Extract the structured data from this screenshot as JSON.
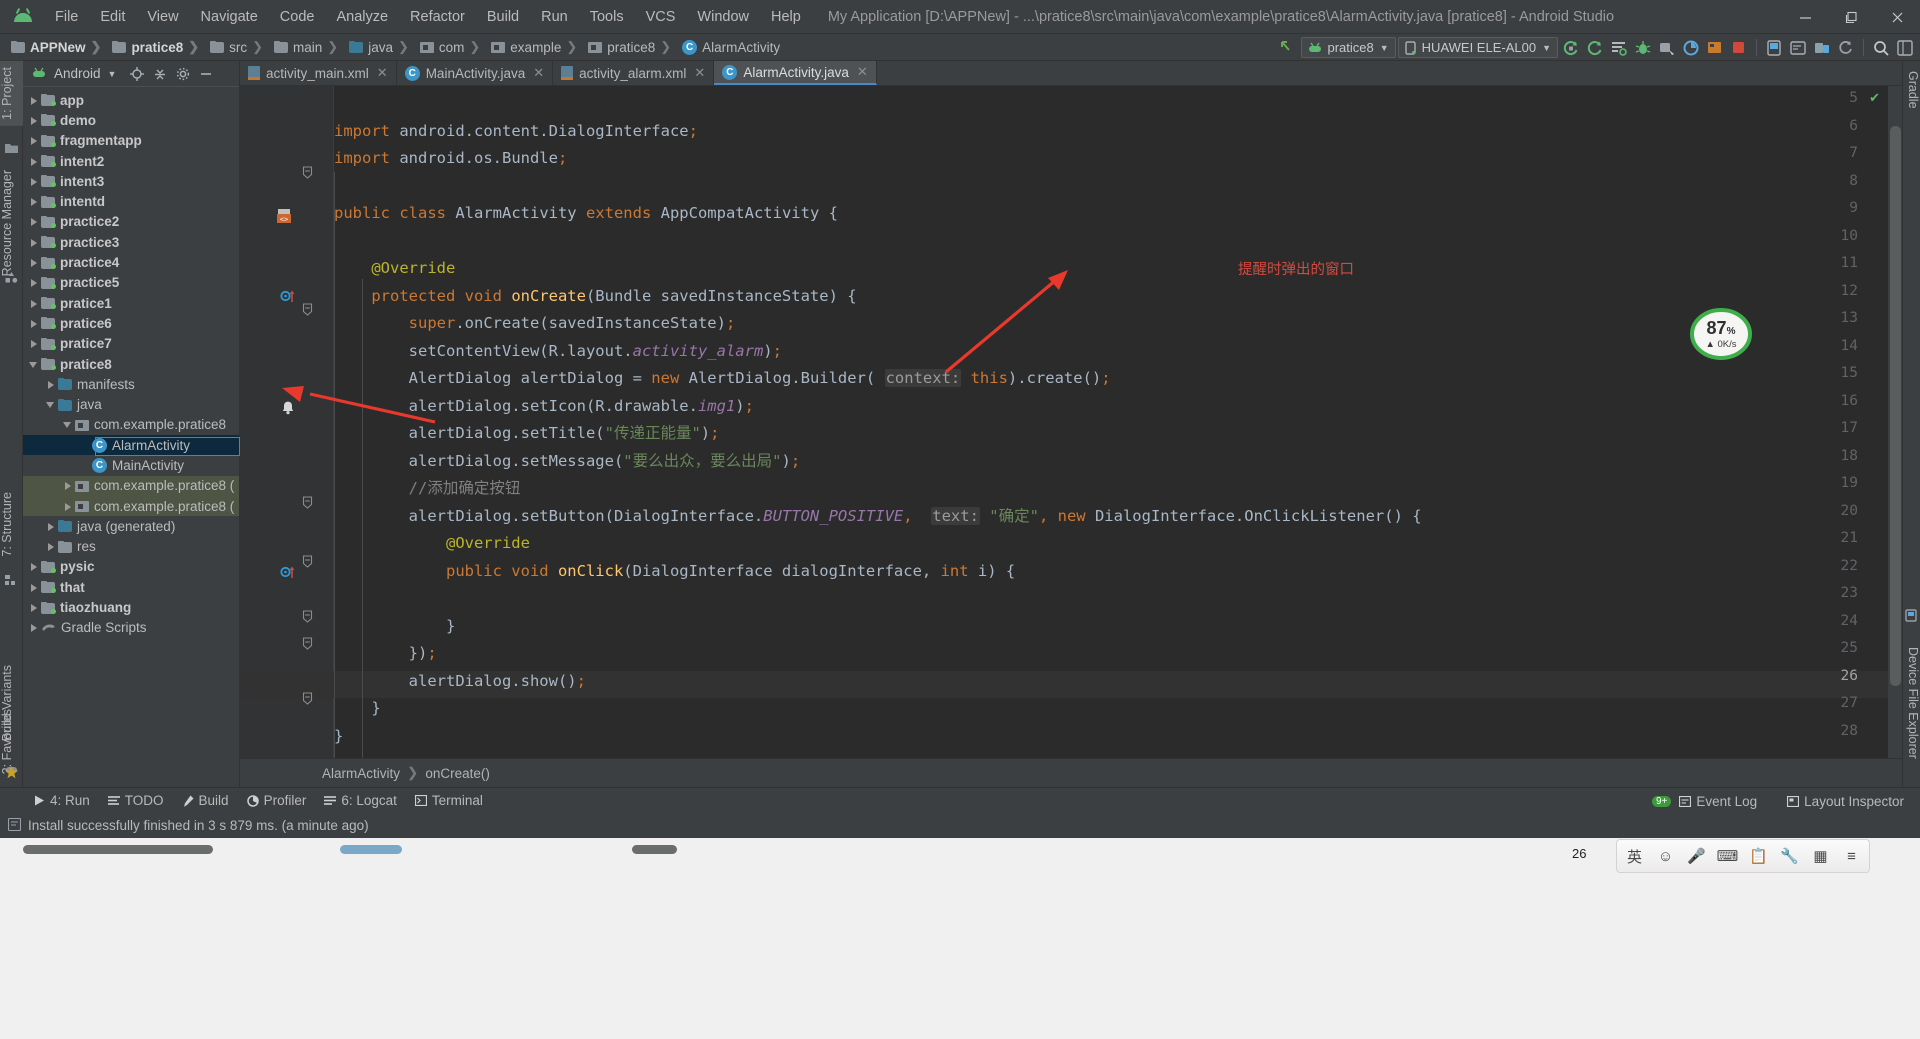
{
  "window": {
    "title": "My Application [D:\\APPNew] - ...\\pratice8\\src\\main\\java\\com\\example\\pratice8\\AlarmActivity.java [pratice8] - Android Studio",
    "minimize_label": "—",
    "maximize_label": "▢",
    "close_label": "✕"
  },
  "menu": [
    {
      "label": "File"
    },
    {
      "label": "Edit"
    },
    {
      "label": "View"
    },
    {
      "label": "Navigate"
    },
    {
      "label": "Code"
    },
    {
      "label": "Analyze"
    },
    {
      "label": "Refactor"
    },
    {
      "label": "Build"
    },
    {
      "label": "Run"
    },
    {
      "label": "Tools"
    },
    {
      "label": "VCS"
    },
    {
      "label": "Window"
    },
    {
      "label": "Help"
    }
  ],
  "breadcrumbs": [
    {
      "label": "APPNew",
      "icon": "folder-module-icon",
      "bold": true
    },
    {
      "label": "pratice8",
      "icon": "folder-module-icon",
      "bold": true
    },
    {
      "label": "src",
      "icon": "folder-icon",
      "bold": false
    },
    {
      "label": "main",
      "icon": "folder-icon",
      "bold": false
    },
    {
      "label": "java",
      "icon": "folder-blue-icon",
      "bold": false
    },
    {
      "label": "com",
      "icon": "package-icon",
      "bold": false
    },
    {
      "label": "example",
      "icon": "package-icon",
      "bold": false
    },
    {
      "label": "pratice8",
      "icon": "package-icon",
      "bold": false
    },
    {
      "label": "AlarmActivity",
      "icon": "class-icon",
      "bold": false
    }
  ],
  "toolbar": {
    "run_config": "pratice8",
    "device": "HUAWEI ELE-AL00",
    "icons": [
      "sync-gradle-icon",
      "avd-manager-icon",
      "sdk-manager-icon",
      "debug-icon",
      "attach-debugger-icon",
      "profiler-icon",
      "layout-inspector-icon",
      "stop-icon",
      "device-file-icon",
      "logcat-icon",
      "search-everywhere-icon",
      "project-structure-icon"
    ]
  },
  "left_strip": [
    {
      "label": "1: Project",
      "selected": true
    },
    {
      "label": "Resource Manager",
      "selected": false
    },
    {
      "label": "7: Structure",
      "selected": false
    },
    {
      "label": "Build Variants",
      "selected": false
    },
    {
      "label": "2: Favorites",
      "selected": false
    }
  ],
  "right_strip": [
    {
      "label": "Gradle"
    },
    {
      "label": "Device File Explorer"
    }
  ],
  "project_panel": {
    "title": "Android",
    "tree": [
      {
        "label": "app",
        "indent": 0,
        "arrow": "closed",
        "icon": "module-folder-icon",
        "bold": true
      },
      {
        "label": "demo",
        "indent": 0,
        "arrow": "closed",
        "icon": "module-folder-icon",
        "bold": true
      },
      {
        "label": "fragmentapp",
        "indent": 0,
        "arrow": "closed",
        "icon": "module-folder-icon",
        "bold": true
      },
      {
        "label": "intent2",
        "indent": 0,
        "arrow": "closed",
        "icon": "module-folder-icon",
        "bold": true
      },
      {
        "label": "intent3",
        "indent": 0,
        "arrow": "closed",
        "icon": "module-folder-icon",
        "bold": true
      },
      {
        "label": "intentd",
        "indent": 0,
        "arrow": "closed",
        "icon": "module-folder-icon",
        "bold": true
      },
      {
        "label": "practice2",
        "indent": 0,
        "arrow": "closed",
        "icon": "module-folder-icon",
        "bold": true
      },
      {
        "label": "practice3",
        "indent": 0,
        "arrow": "closed",
        "icon": "module-folder-icon",
        "bold": true
      },
      {
        "label": "practice4",
        "indent": 0,
        "arrow": "closed",
        "icon": "module-folder-icon",
        "bold": true
      },
      {
        "label": "practice5",
        "indent": 0,
        "arrow": "closed",
        "icon": "module-folder-icon",
        "bold": true
      },
      {
        "label": "pratice1",
        "indent": 0,
        "arrow": "closed",
        "icon": "module-folder-icon",
        "bold": true
      },
      {
        "label": "pratice6",
        "indent": 0,
        "arrow": "closed",
        "icon": "module-folder-icon",
        "bold": true
      },
      {
        "label": "pratice7",
        "indent": 0,
        "arrow": "closed",
        "icon": "module-folder-icon",
        "bold": true
      },
      {
        "label": "pratice8",
        "indent": 0,
        "arrow": "open",
        "icon": "module-folder-icon",
        "bold": true
      },
      {
        "label": "manifests",
        "indent": 1,
        "arrow": "closed",
        "icon": "folder-blue-icon",
        "bold": false
      },
      {
        "label": "java",
        "indent": 1,
        "arrow": "open",
        "icon": "folder-blue-icon",
        "bold": false
      },
      {
        "label": "com.example.pratice8",
        "indent": 2,
        "arrow": "open",
        "icon": "package-icon",
        "bold": false
      },
      {
        "label": "AlarmActivity",
        "indent": 3,
        "arrow": "none",
        "icon": "class-icon",
        "bold": false,
        "selected": true,
        "highlight": true
      },
      {
        "label": "MainActivity",
        "indent": 3,
        "arrow": "none",
        "icon": "class-icon",
        "bold": false
      },
      {
        "label": "com.example.pratice8 (",
        "indent": 2,
        "arrow": "closed",
        "icon": "package-icon",
        "bold": false,
        "green": true
      },
      {
        "label": "com.example.pratice8 (",
        "indent": 2,
        "arrow": "closed",
        "icon": "package-icon",
        "bold": false,
        "green": true
      },
      {
        "label": "java (generated)",
        "indent": 1,
        "arrow": "closed",
        "icon": "folder-generated-icon",
        "bold": false
      },
      {
        "label": "res",
        "indent": 1,
        "arrow": "closed",
        "icon": "res-folder-icon",
        "bold": false
      },
      {
        "label": "pysic",
        "indent": 0,
        "arrow": "closed",
        "icon": "module-folder-icon",
        "bold": true
      },
      {
        "label": "that",
        "indent": 0,
        "arrow": "closed",
        "icon": "module-folder-icon",
        "bold": true
      },
      {
        "label": "tiaozhuang",
        "indent": 0,
        "arrow": "closed",
        "icon": "module-folder-icon",
        "bold": true
      },
      {
        "label": "Gradle Scripts",
        "indent": 0,
        "arrow": "closed",
        "icon": "gradle-icon",
        "bold": false
      }
    ]
  },
  "editor_tabs": [
    {
      "label": "activity_main.xml",
      "icon": "xml-layout-icon",
      "active": false
    },
    {
      "label": "MainActivity.java",
      "icon": "class-icon",
      "active": false
    },
    {
      "label": "activity_alarm.xml",
      "icon": "xml-layout-icon",
      "active": false
    },
    {
      "label": "AlarmActivity.java",
      "icon": "class-icon",
      "active": true
    }
  ],
  "code": {
    "first_line_number": 5,
    "current_line": 26,
    "lines": [
      {
        "n": 5,
        "tokens": []
      },
      {
        "n": 6,
        "tokens": [
          {
            "t": "kw",
            "v": "import"
          },
          {
            "t": "txt",
            "v": " android.content.DialogInterface"
          },
          {
            "t": "kw",
            "v": ";"
          }
        ]
      },
      {
        "n": 7,
        "tokens": [
          {
            "t": "kw",
            "v": "import"
          },
          {
            "t": "txt",
            "v": " android.os.Bundle"
          },
          {
            "t": "kw",
            "v": ";"
          }
        ]
      },
      {
        "n": 8,
        "tokens": []
      },
      {
        "n": 9,
        "tokens": [
          {
            "t": "kw",
            "v": "public class "
          },
          {
            "t": "txt",
            "v": "AlarmActivity "
          },
          {
            "t": "kw",
            "v": "extends "
          },
          {
            "t": "txt",
            "v": "AppCompatActivity {"
          }
        ]
      },
      {
        "n": 10,
        "tokens": []
      },
      {
        "n": 11,
        "tokens": [
          {
            "t": "sp",
            "v": "    "
          },
          {
            "t": "annot",
            "v": "@Override"
          }
        ]
      },
      {
        "n": 12,
        "tokens": [
          {
            "t": "sp",
            "v": "    "
          },
          {
            "t": "kw",
            "v": "protected void "
          },
          {
            "t": "mth",
            "v": "onCreate"
          },
          {
            "t": "txt",
            "v": "(Bundle savedInstanceState) {"
          }
        ]
      },
      {
        "n": 13,
        "tokens": [
          {
            "t": "sp",
            "v": "        "
          },
          {
            "t": "kw",
            "v": "super"
          },
          {
            "t": "txt",
            "v": ".onCreate(savedInstanceState)"
          },
          {
            "t": "kw",
            "v": ";"
          }
        ]
      },
      {
        "n": 14,
        "tokens": [
          {
            "t": "sp",
            "v": "        "
          },
          {
            "t": "txt",
            "v": "setContentView(R.layout."
          },
          {
            "t": "fld",
            "v": "activity_alarm"
          },
          {
            "t": "txt",
            "v": ")"
          },
          {
            "t": "kw",
            "v": ";"
          }
        ]
      },
      {
        "n": 15,
        "tokens": [
          {
            "t": "sp",
            "v": "        "
          },
          {
            "t": "txt",
            "v": "AlertDialog alertDialog = "
          },
          {
            "t": "kw",
            "v": "new "
          },
          {
            "t": "txt",
            "v": "AlertDialog.Builder( "
          },
          {
            "t": "hint",
            "v": "context:"
          },
          {
            "t": "txt",
            "v": " "
          },
          {
            "t": "kw",
            "v": "this"
          },
          {
            "t": "txt",
            "v": ").create()"
          },
          {
            "t": "kw",
            "v": ";"
          }
        ]
      },
      {
        "n": 16,
        "tokens": [
          {
            "t": "sp",
            "v": "        "
          },
          {
            "t": "txt",
            "v": "alertDialog.setIcon(R.drawable."
          },
          {
            "t": "fld",
            "v": "img1"
          },
          {
            "t": "txt",
            "v": ")"
          },
          {
            "t": "kw",
            "v": ";"
          }
        ]
      },
      {
        "n": 17,
        "tokens": [
          {
            "t": "sp",
            "v": "        "
          },
          {
            "t": "txt",
            "v": "alertDialog.setTitle("
          },
          {
            "t": "str",
            "v": "\"传递正能量\""
          },
          {
            "t": "txt",
            "v": ")"
          },
          {
            "t": "kw",
            "v": ";"
          }
        ]
      },
      {
        "n": 18,
        "tokens": [
          {
            "t": "sp",
            "v": "        "
          },
          {
            "t": "txt",
            "v": "alertDialog.setMessage("
          },
          {
            "t": "str",
            "v": "\"要么出众，要么出局\""
          },
          {
            "t": "txt",
            "v": ")"
          },
          {
            "t": "kw",
            "v": ";"
          }
        ]
      },
      {
        "n": 19,
        "tokens": [
          {
            "t": "sp",
            "v": "        "
          },
          {
            "t": "cmt",
            "v": "//添加确定按钮"
          }
        ]
      },
      {
        "n": 20,
        "tokens": [
          {
            "t": "sp",
            "v": "        "
          },
          {
            "t": "txt",
            "v": "alertDialog.setButton(DialogInterface."
          },
          {
            "t": "fld",
            "v": "BUTTON_POSITIVE"
          },
          {
            "t": "kw",
            "v": ","
          },
          {
            "t": "txt",
            "v": "  "
          },
          {
            "t": "hint",
            "v": "text:"
          },
          {
            "t": "txt",
            "v": " "
          },
          {
            "t": "str",
            "v": "\"确定\""
          },
          {
            "t": "kw",
            "v": ", "
          },
          {
            "t": "kw",
            "v": "new "
          },
          {
            "t": "txt",
            "v": "DialogInterface.OnClickListener() {"
          }
        ]
      },
      {
        "n": 21,
        "tokens": [
          {
            "t": "sp",
            "v": "            "
          },
          {
            "t": "annot",
            "v": "@Override"
          }
        ]
      },
      {
        "n": 22,
        "tokens": [
          {
            "t": "sp",
            "v": "            "
          },
          {
            "t": "kw",
            "v": "public void "
          },
          {
            "t": "mth",
            "v": "onClick"
          },
          {
            "t": "txt",
            "v": "(DialogInterface dialogInterface, "
          },
          {
            "t": "kw",
            "v": "int "
          },
          {
            "t": "txt",
            "v": "i) {"
          }
        ]
      },
      {
        "n": 23,
        "tokens": []
      },
      {
        "n": 24,
        "tokens": [
          {
            "t": "sp",
            "v": "            "
          },
          {
            "t": "txt",
            "v": "}"
          }
        ]
      },
      {
        "n": 25,
        "tokens": [
          {
            "t": "sp",
            "v": "        "
          },
          {
            "t": "txt",
            "v": "})"
          },
          {
            "t": "kw",
            "v": ";"
          }
        ]
      },
      {
        "n": 26,
        "tokens": [
          {
            "t": "sp",
            "v": "        "
          },
          {
            "t": "txt",
            "v": "alertDialog.show()"
          },
          {
            "t": "kw",
            "v": ";"
          }
        ]
      },
      {
        "n": 27,
        "tokens": [
          {
            "t": "sp",
            "v": "    "
          },
          {
            "t": "txt",
            "v": "}"
          }
        ]
      },
      {
        "n": 28,
        "tokens": [
          {
            "t": "txt",
            "v": "}"
          }
        ]
      }
    ]
  },
  "editor_breadcrumb": [
    {
      "label": "AlarmActivity"
    },
    {
      "label": "onCreate()"
    }
  ],
  "annotations": {
    "note_text": "提醒时弹出的窗口",
    "note_color": "#d44a3f",
    "arrow_color": "#e8392c"
  },
  "memory_widget": {
    "percent": "87",
    "percent_symbol": "%",
    "rate": "0K/s",
    "ring_color": "#3fae4a"
  },
  "bottom_bar": {
    "left": [
      {
        "label": "4: Run",
        "icon": "run-icon"
      },
      {
        "label": "TODO",
        "icon": "todo-icon"
      },
      {
        "label": "Build",
        "icon": "build-icon"
      },
      {
        "label": "Profiler",
        "icon": "profiler-icon"
      },
      {
        "label": "6: Logcat",
        "icon": "logcat-icon"
      },
      {
        "label": "Terminal",
        "icon": "terminal-icon"
      }
    ],
    "right": [
      {
        "label": "Event Log",
        "icon": "event-log-icon",
        "badge": "9+"
      },
      {
        "label": "Layout Inspector",
        "icon": "layout-inspector-icon",
        "badge": ""
      }
    ]
  },
  "status_bar": {
    "message": "Install successfully finished in 3 s 879 ms. (a minute ago)",
    "icon": "info-icon"
  },
  "taskbar": {
    "clock": "26",
    "ime_buttons": [
      "英",
      "☺",
      "🎤",
      "⌨",
      "📋",
      "🔧",
      "▦",
      "≡"
    ]
  }
}
